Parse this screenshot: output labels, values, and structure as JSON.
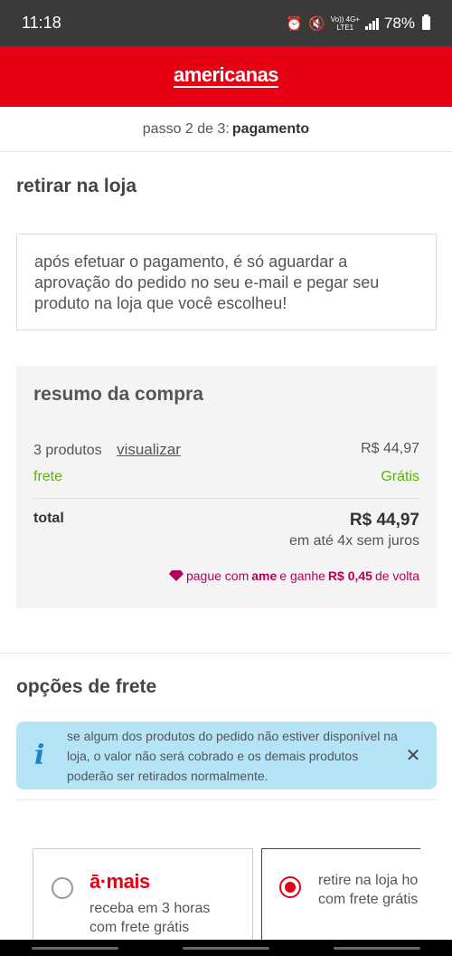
{
  "status_bar": {
    "time": "11:18",
    "network_top": "Vo)) 4G+",
    "network_bottom": "LTE1",
    "battery": "78%"
  },
  "header": {
    "logo": "americanas"
  },
  "step": {
    "prefix": "passo 2 de 3:",
    "current": "pagamento"
  },
  "pickup": {
    "title": "retirar na loja",
    "info": "após efetuar o pagamento, é só aguardar a aprovação do pedido no seu e-mail e pegar seu produto na loja que você escolheu!"
  },
  "summary": {
    "title": "resumo da compra",
    "products_label": "3 produtos",
    "view_link": "visualizar",
    "products_value": "R$ 44,97",
    "shipping_label": "frete",
    "shipping_value": "Grátis",
    "total_label": "total",
    "total_value": "R$ 44,97",
    "installments": "em até 4x sem juros",
    "ame_prefix": "pague com",
    "ame_brand": "ame",
    "ame_middle": "e ganhe",
    "ame_cashback": "R$ 0,45",
    "ame_suffix": "de volta"
  },
  "shipping_options": {
    "title": "opções de frete",
    "alert_text": "se algum dos produtos do pedido não estiver disponível na loja, o valor não será cobrado e os demais produtos poderão ser retirados normalmente.",
    "option1": {
      "brand": "ā·mais",
      "line1": "receba em 3 horas",
      "line2": "com frete grátis",
      "selected": false
    },
    "option2": {
      "line1": "retire na loja ho",
      "line2": "com frete grátis",
      "selected": true
    }
  },
  "colors": {
    "brand_red": "#e60014",
    "success_green": "#5ab400",
    "ame_pink": "#b3005e",
    "alert_blue": "#b5e4f7"
  },
  "icons": [
    "alarm-icon",
    "mute-icon",
    "signal-icon",
    "battery-icon",
    "gem-icon",
    "info-icon",
    "close-icon"
  ]
}
